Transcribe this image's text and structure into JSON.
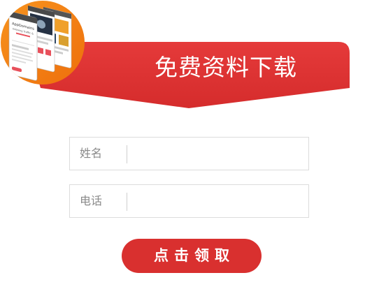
{
  "banner": {
    "title": "免费资料下载",
    "color": "#e03535"
  },
  "badge": {
    "color": "#f47e0f",
    "icon": "phone-mockups-image",
    "phone_title": "AppDomains",
    "phone_subtitle": "Growing Traffic &"
  },
  "form": {
    "name_label": "姓名",
    "name_value": "",
    "phone_label": "电话",
    "phone_value": ""
  },
  "submit": {
    "label": "点击领取",
    "color": "#d9302f"
  }
}
